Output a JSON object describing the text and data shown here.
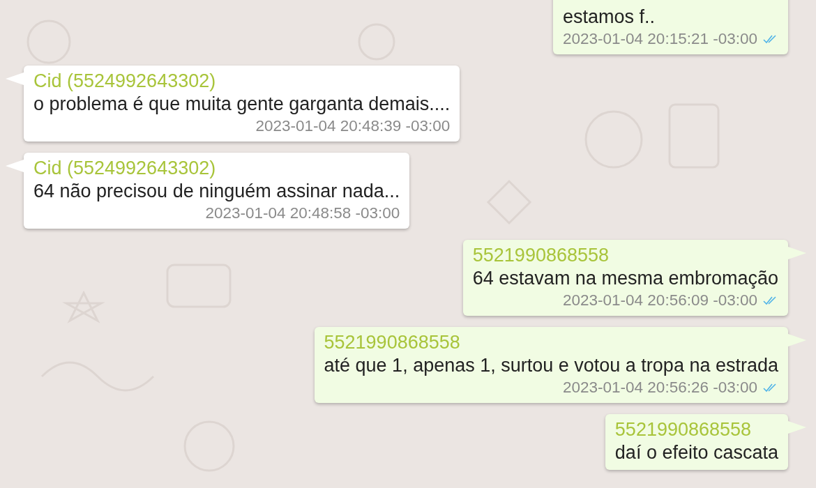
{
  "messages": [
    {
      "kind": "outgoing",
      "text": "estamos f..",
      "time": "2023-01-04 20:15:21 -03:00",
      "read": true
    },
    {
      "kind": "incoming",
      "sender": "Cid (5524992643302)",
      "text": "o problema é que muita gente garganta demais....",
      "time": "2023-01-04 20:48:39 -03:00"
    },
    {
      "kind": "incoming",
      "sender": "Cid (5524992643302)",
      "text": "64 não precisou de ninguém assinar nada...",
      "time": "2023-01-04 20:48:58 -03:00"
    },
    {
      "kind": "outgoing",
      "sender": "5521990868558",
      "text": "64 estavam na mesma embromação",
      "time": "2023-01-04 20:56:09 -03:00",
      "read": true
    },
    {
      "kind": "outgoing",
      "sender": "5521990868558",
      "text": "até que 1, apenas 1, surtou e votou a tropa na estrada",
      "time": "2023-01-04 20:56:26 -03:00",
      "read": true
    },
    {
      "kind": "outgoing",
      "sender": "5521990868558",
      "text": "daí o efeito cascata"
    }
  ]
}
